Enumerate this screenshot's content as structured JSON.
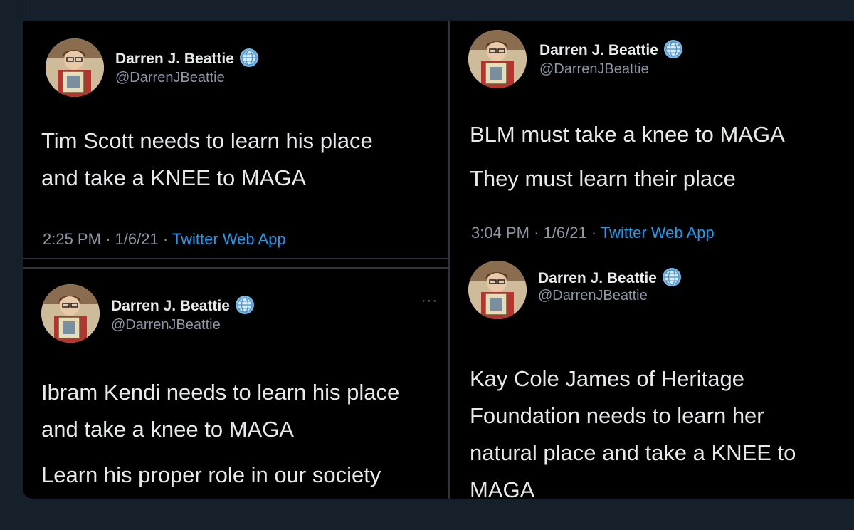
{
  "tweets": [
    {
      "name": "Darren J. Beattie",
      "handle": "@DarrenJBeattie",
      "lines": [
        "Tim Scott needs to learn his place",
        "and take a KNEE to MAGA"
      ],
      "time": "2:25 PM",
      "date": "1/6/21",
      "app": "Twitter Web App",
      "sep": "·"
    },
    {
      "name": "Darren J. Beattie",
      "handle": "@DarrenJBeattie",
      "lines": [
        "BLM must take a knee to MAGA",
        "They must learn their place"
      ],
      "time": "3:04 PM",
      "date": "1/6/21",
      "app": "Twitter Web App",
      "sep": "·"
    },
    {
      "name": "Darren J. Beattie",
      "handle": "@DarrenJBeattie",
      "lines": [
        "Ibram Kendi needs to learn his place",
        "and take a knee to MAGA",
        "Learn his proper role in our society"
      ],
      "more": "···"
    },
    {
      "name": "Darren J. Beattie",
      "handle": "@DarrenJBeattie",
      "lines": [
        "Kay Cole James of Heritage",
        "Foundation needs to learn her",
        "natural place and take a KNEE to",
        "MAGA"
      ]
    }
  ],
  "icons": {
    "verified": "globe-badge-icon",
    "more": "more-dots-icon"
  },
  "colors": {
    "background": "#15202b",
    "tweet_bg": "#000000",
    "text": "#e7e9ea",
    "secondary": "#8b98a5",
    "link": "#1d9bf0"
  }
}
